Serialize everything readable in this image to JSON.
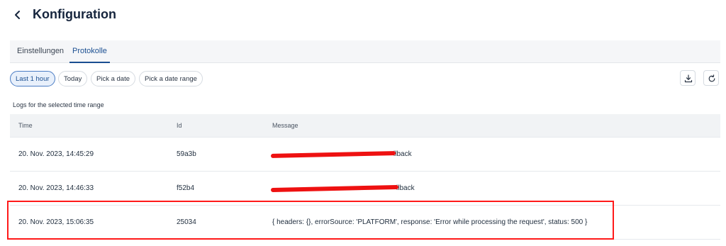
{
  "header": {
    "title": "Konfiguration"
  },
  "tabs": [
    {
      "label": "Einstellungen"
    },
    {
      "label": "Protokolle",
      "active": true
    }
  ],
  "filters": [
    {
      "label": "Last 1 hour",
      "active": true
    },
    {
      "label": "Today"
    },
    {
      "label": "Pick a date"
    },
    {
      "label": "Pick a date range"
    }
  ],
  "toolbar": {
    "download_icon": "download-icon",
    "refresh_icon": "refresh-icon"
  },
  "logs": {
    "caption": "Logs for the selected time range",
    "columns": {
      "time": "Time",
      "id": "Id",
      "message": "Message"
    },
    "rows": [
      {
        "time": "20. Nov. 2023, 14:45:29",
        "id": "59a3b",
        "message": "llback"
      },
      {
        "time": "20. Nov. 2023, 14:46:33",
        "id": "f52b4",
        "message": "llback"
      },
      {
        "time": "20. Nov. 2023, 15:06:35",
        "id": "25034",
        "message": "{ headers: {}, errorSource: 'PLATFORM', response: 'Error while processing the request', status: 500 }"
      }
    ]
  },
  "colors": {
    "accent": "#1b4f91",
    "highlight": "#ff1a1a"
  }
}
